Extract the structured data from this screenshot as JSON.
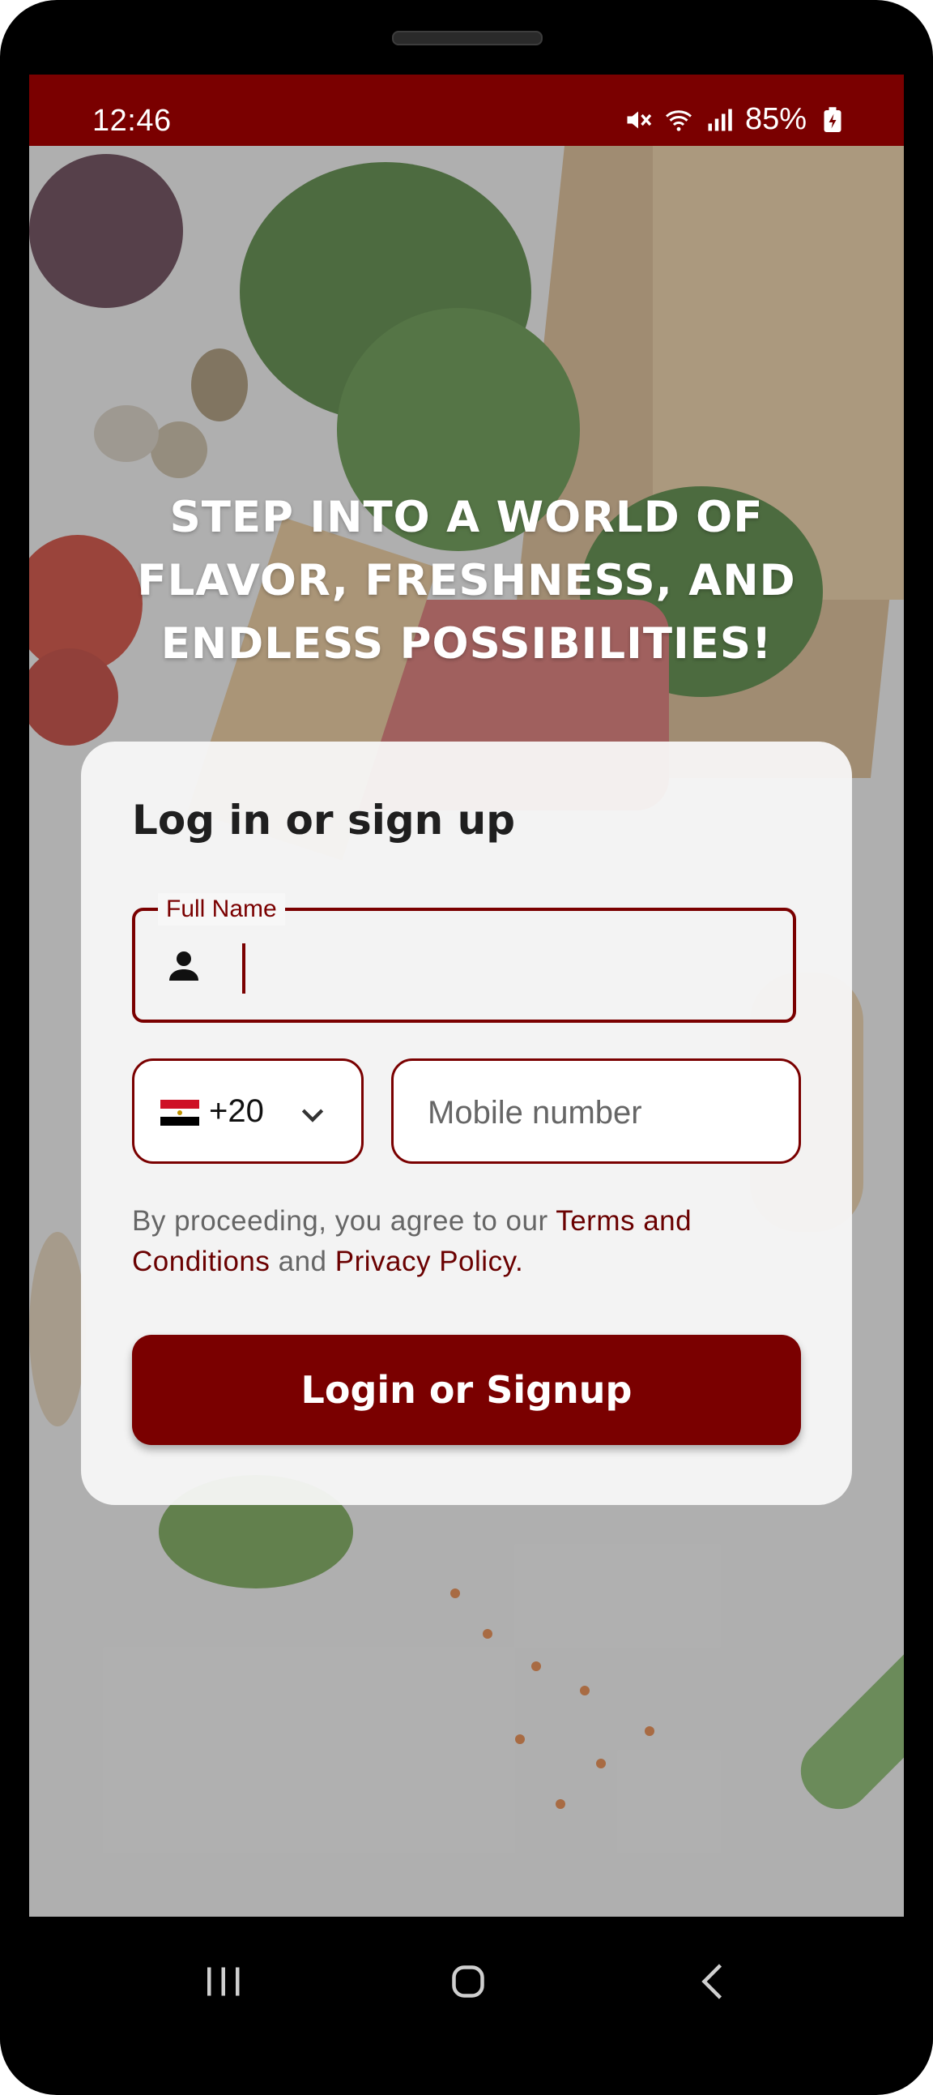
{
  "status_bar": {
    "time": "12:46",
    "battery": "85%",
    "icons": [
      "mute-icon",
      "wifi-icon",
      "signal-icon",
      "battery-charging-icon"
    ]
  },
  "headline": "STEP INTO A WORLD OF FLAVOR, FRESHNESS, AND ENDLESS POSSIBILITIES!",
  "card": {
    "title": "Log in or sign up",
    "full_name_label": "Full Name",
    "full_name_value": "",
    "country": {
      "flag": "egypt-flag",
      "code": "+20"
    },
    "mobile_placeholder": "Mobile number",
    "terms": {
      "prefix": "By proceeding, you agree to our ",
      "terms_link": "Terms and Conditions",
      "middle": " and ",
      "privacy_link": "Privacy Policy."
    },
    "cta": "Login or Signup"
  },
  "nav": [
    "recent-apps-icon",
    "home-icon",
    "back-icon"
  ],
  "colors": {
    "brand": "#7a0000",
    "card_bg": "#f8f8f8",
    "text_dark": "#1f1f1f"
  }
}
